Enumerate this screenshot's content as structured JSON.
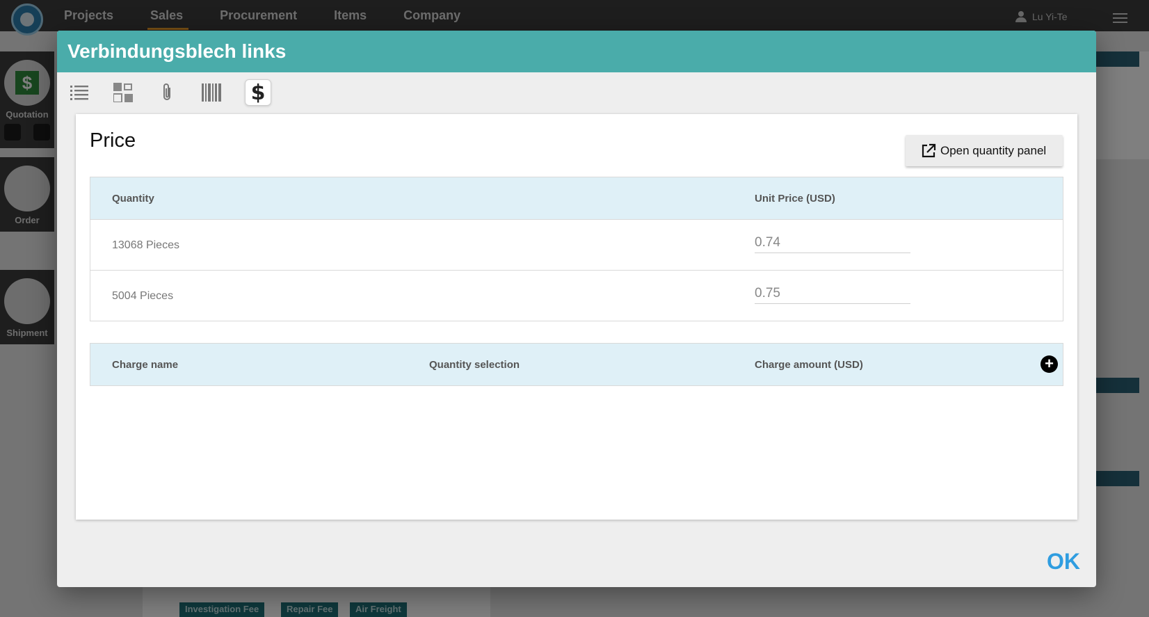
{
  "app": {
    "nav": [
      "Projects",
      "Sales",
      "Procurement",
      "Items",
      "Company"
    ],
    "active_nav": "Sales",
    "user_name": "Lu Yi-Te",
    "sidebar": {
      "quotation_label": "Quotation",
      "order_label": "Order",
      "shipment_label": "Shipment"
    },
    "background_tags": [
      "Investigation Fee",
      "Repair Fee",
      "Air Freight"
    ]
  },
  "dialog": {
    "title": "Verbindungsblech links",
    "toolbar": {
      "icons": [
        "list-icon",
        "grid-icon",
        "paperclip-icon",
        "barcode-icon",
        "dollar-icon"
      ],
      "active": "dollar-icon"
    },
    "price_section": {
      "title": "Price",
      "open_quantity_panel_label": "Open quantity panel",
      "quantity_header": "Quantity",
      "unit_price_header": "Unit Price (USD)",
      "rows": [
        {
          "quantity": "13068 Pieces",
          "unit_price": "0.74"
        },
        {
          "quantity": "5004 Pieces",
          "unit_price": "0.75"
        }
      ]
    },
    "charges": {
      "charge_name_header": "Charge name",
      "quantity_selection_header": "Quantity selection",
      "charge_amount_header": "Charge amount (USD)",
      "add_label": "+"
    },
    "ok_label": "OK"
  }
}
